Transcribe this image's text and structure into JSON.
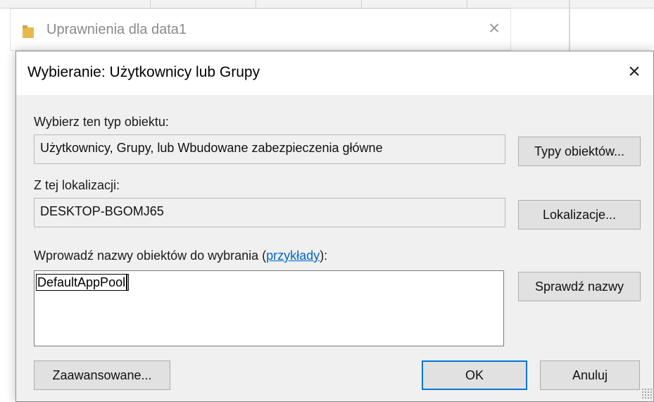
{
  "background_window": {
    "title": "Uprawnienia dla data1",
    "close_glyph": "×"
  },
  "dialog": {
    "title": "Wybieranie: Użytkownicy lub Grupy",
    "close_glyph": "×",
    "object_type": {
      "label": "Wybierz ten typ obiektu:",
      "value": "Użytkownicy, Grupy, lub Wbudowane zabezpieczenia główne",
      "button": "Typy obiektów..."
    },
    "location": {
      "label": "Z tej lokalizacji:",
      "value": "DESKTOP-BGOMJ65",
      "button": "Lokalizacje..."
    },
    "names": {
      "label_prefix": "Wprowadź nazwy obiektów do wybrania (",
      "link": "przykłady",
      "label_suffix": "):",
      "value": "DefaultAppPool",
      "button": "Sprawdź nazwy"
    },
    "advanced_button": "Zaawansowane...",
    "ok_button": "OK",
    "cancel_button": "Anuluj"
  },
  "colors": {
    "dialog_bg": "#f0f0f0",
    "accent": "#0078d7",
    "link": "#0066cc"
  },
  "icons": {
    "background_window_icon": "folder-icon",
    "resize": "resize-grip-icon"
  }
}
